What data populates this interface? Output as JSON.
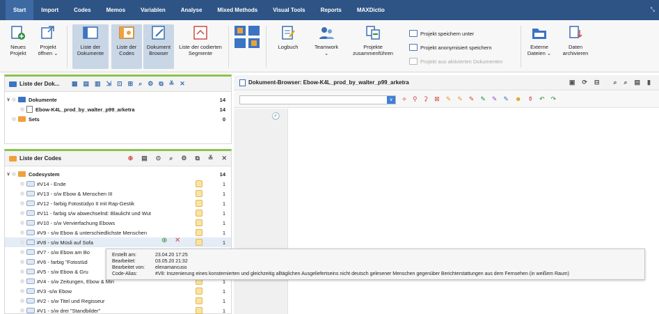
{
  "menu": {
    "tabs": [
      "Start",
      "Import",
      "Codes",
      "Memos",
      "Variablen",
      "Analyse",
      "Mixed Methods",
      "Visual Tools",
      "Reports",
      "MAXDictio"
    ],
    "active": "Start",
    "corner": "⤡"
  },
  "ribbon": {
    "neues_projekt": "Neues\nProjekt",
    "projekt_oeffnen": "Projekt\nöffnen ⌄",
    "liste_dokumente": "Liste der\nDokumente",
    "liste_codes": "Liste der\nCodes",
    "dokument_browser": "Dokument\nBrowser",
    "liste_segmente": "Liste der codierten\nSegmente",
    "logbuch": "Logbuch",
    "teamwork": "Teamwork\n⌄",
    "projekte_zusammen": "Projekte\nzusammenführen",
    "speichern_unter": "Projekt speichern unter",
    "anonymisiert": "Projekt anonymisiert speichern",
    "aktivierte": "Projekt aus aktivierten Dokumenten",
    "externe_dateien": "Externe\nDateien ⌄",
    "daten_archivieren": "Daten\narchivieren"
  },
  "docs_panel": {
    "title": "Liste der Dok...",
    "rows": [
      {
        "label": "Dokumente",
        "count": "14"
      },
      {
        "label": "Ebow-K4L_prod_by_walter_p99_arketra",
        "count": "14"
      },
      {
        "label": "Sets",
        "count": "0"
      }
    ]
  },
  "codes_panel": {
    "title": "Liste der Codes",
    "root": {
      "label": "Codesystem",
      "count": "14"
    },
    "rows": [
      {
        "label": "#V14 - Ende",
        "count": "1"
      },
      {
        "label": "#V13 - s/w Ebow & Menschen III",
        "count": "1"
      },
      {
        "label": "#V12 - farbig Fotostüdyo II mit Rap-Gestik",
        "count": "1"
      },
      {
        "label": "#V11 - farbig s/w abwechselnd: Blaulicht und Wut",
        "count": "1"
      },
      {
        "label": "#V10 - s/w Vervierfachung Ebows",
        "count": "1"
      },
      {
        "label": "#V9 - s/w Ebow & unterschiedlichste Menschen",
        "count": "1"
      },
      {
        "label": "#V8 - s/w Müsli auf Sofa",
        "count": "1"
      },
      {
        "label": "#V7 - s/w Ebow am Bo",
        "count": "1"
      },
      {
        "label": "#V6 - farbig \"Fotostüd",
        "count": "1"
      },
      {
        "label": "#V5 - s/w Ebow & Gru",
        "count": "1"
      },
      {
        "label": "#V4 - s/w Zeitungen, Ebow & Miri",
        "count": "1"
      },
      {
        "label": "#V3 -s/w Ebow",
        "count": "1"
      },
      {
        "label": "#V2 - s/w Titel und Regisseur",
        "count": "1"
      },
      {
        "label": "#V1 - s/w drei \"Standbilder\"",
        "count": "1"
      }
    ]
  },
  "browser": {
    "title": "Dokument-Browser: Ebow-K4L_prod_by_walter_p99_arketra",
    "clock": "🕘"
  },
  "tooltip": {
    "erstellt_k": "Erstellt am:",
    "erstellt_v": "23.04.20 17:25",
    "bearbeitet_k": "Bearbeitet:",
    "bearbeitet_v": "03.05.20 21:32",
    "von_k": "Bearbeitet von:",
    "von_v": "elenamancuso",
    "alias_k": "Code-Alias:",
    "alias_v": "#V8: Inszenierung eines konsternierten und gleichzeitig alltäglichen Ausgeliefertseins nicht deutsch gelesener Menschen gegenüber Berichterstattungen aus dem Fernsehen (in weißem Raum)"
  },
  "colors": {
    "menubar": "#2e5486",
    "accent": "#3d7fd9",
    "green": "#8bc34a",
    "orange": "#f0a03a"
  }
}
